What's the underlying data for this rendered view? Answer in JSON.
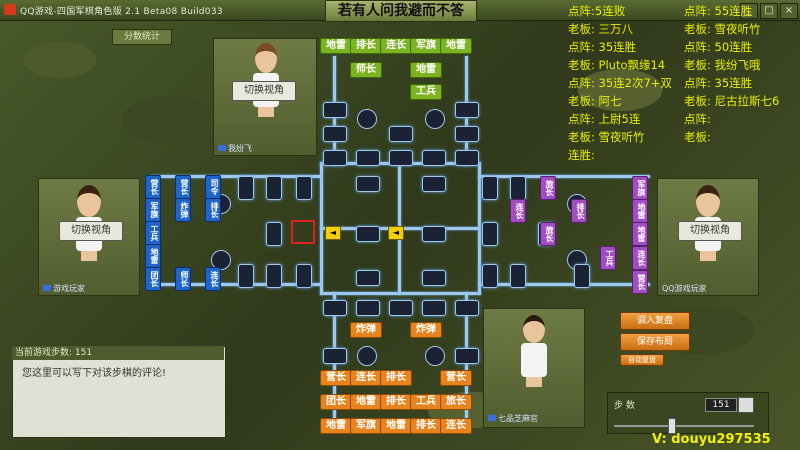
{
  "window": {
    "title": "QQ游戏-四国军棋角色版 2.1 Beta08 Build033",
    "banner": "若有人问我避而不答",
    "controls": [
      "_",
      "□",
      "×"
    ]
  },
  "score_stats_label": "分数统计",
  "switch_view_label": "切换视角",
  "players": {
    "top": "我纷飞",
    "left": "游戏玩家",
    "right": "QQ游戏玩家",
    "bottom": "七品芝麻官"
  },
  "pieces": {
    "top_row1": [
      "地雷",
      "排长",
      "连长",
      "军旗",
      "地雷"
    ],
    "top_row2": [
      "师长",
      "地雷"
    ],
    "top_row3": [
      "工兵"
    ],
    "bottom_row1": [
      "炸弹",
      "炸弹"
    ],
    "bottom_row2": [
      "营长",
      "连长",
      "排长",
      "营长"
    ],
    "bottom_row3": [
      "团长",
      "地雷",
      "排长",
      "工兵",
      "旅长"
    ],
    "bottom_row4": [
      "地雷",
      "军旗",
      "地雷",
      "排长",
      "连长"
    ],
    "left_col1": [
      "营长",
      "军旗",
      "工兵",
      "地雷",
      "团长"
    ],
    "left_col2": [
      "营长",
      "炸弹",
      "师长"
    ],
    "left_col3": [
      "司令",
      "排长",
      "连长"
    ],
    "right_col1": [
      "旅长",
      "连长",
      "排长"
    ],
    "right_col2": [
      "旅长",
      "工兵"
    ],
    "right_col3": [
      "军旗",
      "地雷",
      "地雷",
      "连长",
      "营长"
    ]
  },
  "stream_overlay": {
    "left": [
      "点阵:5连败",
      "老板: 三万八",
      "点阵: 35连胜",
      "老板: Pluto飘缘14",
      "点阵: 35连2次7+双",
      "老板: 阿七",
      "点阵: 上尉5连",
      "老板: 雪夜听竹",
      "连胜:"
    ],
    "right": [
      "点阵: 55连胜",
      "老板: 雪夜听竹",
      "点阵: 50连胜",
      "老板: 我纷飞哦",
      "点阵: 35连胜",
      "老板: 尼古拉斯七6",
      "点阵:",
      "老板:"
    ],
    "watermark": "V: douyu297535"
  },
  "current_steps_label": "当前游戏步数: 151",
  "comment_placeholder": "您这里可以写下对该步棋的评论!",
  "buttons": {
    "load": "调入复盘",
    "save": "保存布局",
    "auto": "自动复盘"
  },
  "steps": {
    "label": "步 数",
    "value": "151"
  },
  "colors": {
    "green_team": "#7cb321",
    "orange_team": "#e8841b",
    "blue_team": "#1f64c9",
    "purple_team": "#a14ec2",
    "overlay_text": "#e8f000"
  }
}
